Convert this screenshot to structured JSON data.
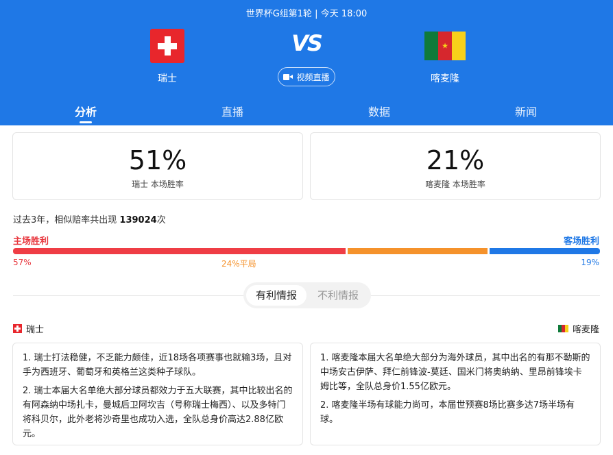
{
  "header": {
    "match_title": "世界杯G组第1轮 | 今天 18:00",
    "vs_text": "VS",
    "live_button": "视频直播",
    "home_team": "瑞士",
    "away_team": "喀麦隆"
  },
  "tabs": [
    {
      "label": "分析",
      "active": true
    },
    {
      "label": "直播",
      "active": false
    },
    {
      "label": "数据",
      "active": false
    },
    {
      "label": "新闻",
      "active": false
    }
  ],
  "win_rates": {
    "home_pct": "51%",
    "home_label": "瑞士 本场胜率",
    "away_pct": "21%",
    "away_label": "喀麦隆 本场胜率"
  },
  "history": {
    "prefix": "过去3年，相似赔率共出现",
    "count": "139024",
    "suffix": "次"
  },
  "results": {
    "home_label": "主场胜利",
    "away_label": "客场胜利",
    "home_pct_text": "57%",
    "draw_pct_text": "24%平局",
    "away_pct_text": "19%",
    "home_value": 57,
    "draw_value": 24,
    "away_value": 19,
    "colors": {
      "home": "#ef3d45",
      "draw": "#f5922b",
      "away": "#1f78e6"
    }
  },
  "intel_toggle": {
    "favorable": "有利情报",
    "unfavorable": "不利情报",
    "selected": "有利情报"
  },
  "intel": {
    "home_team": "瑞士",
    "away_team": "喀麦隆",
    "home_items": [
      "1. 瑞士打法稳健，不乏能力颇佳，近18场各项赛事也就输3场，且对手为西班牙、葡萄牙和英格兰这类种子球队。",
      "2. 瑞士本届大名单绝大部分球员都效力于五大联赛，其中比较出名的有阿森纳中场扎卡，曼城后卫阿坎吉（号称瑞士梅西）、以及多特门将科贝尔，此外老将沙奇里也成功入选，全队总身价高达2.88亿欧元。"
    ],
    "away_items": [
      "1. 喀麦隆本届大名单绝大部分为海外球员，其中出名的有那不勒斯的中场安古伊萨、拜仁前锋波-莫廷、国米门将奥纳纳、里昂前锋埃卡姆比等，全队总身价1.55亿欧元。",
      "2. 喀麦隆半场有球能力尚可，本届世预赛8场比赛多达7场半场有球。"
    ]
  },
  "icons": [
    "switzerland-flag-icon",
    "cameroon-flag-icon",
    "video-camera-icon"
  ]
}
